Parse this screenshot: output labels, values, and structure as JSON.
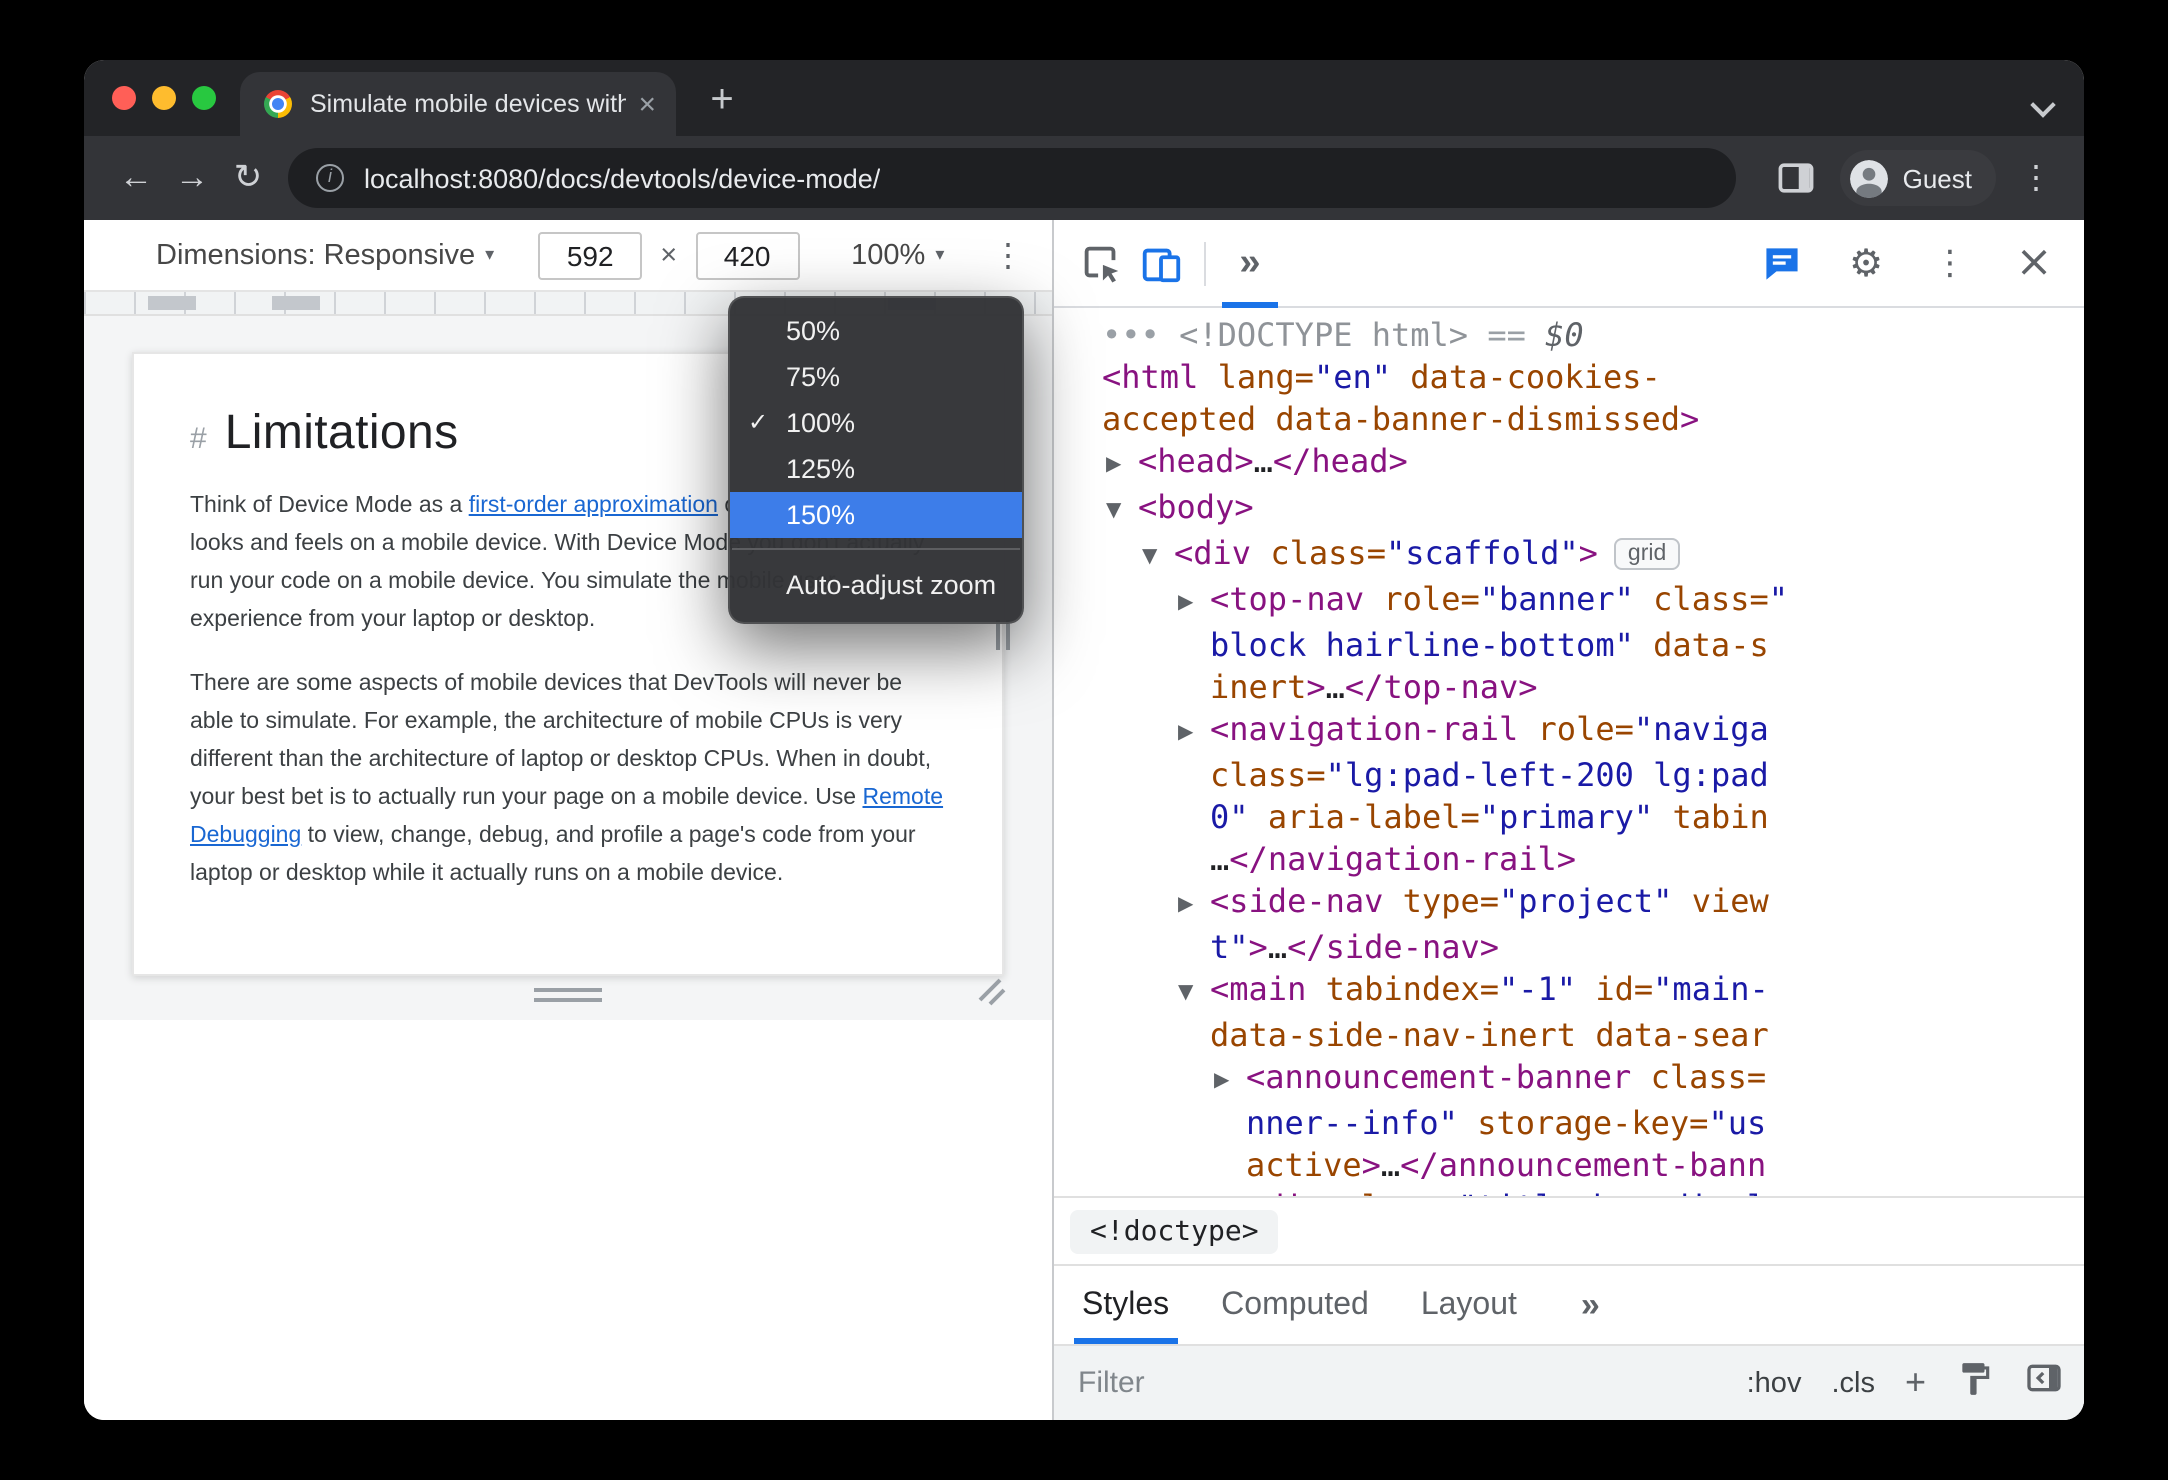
{
  "browser": {
    "tab_title": "Simulate mobile devices with D",
    "tab_close": "×",
    "new_tab": "+",
    "back": "←",
    "forward": "→",
    "reload": "↻",
    "info": "i",
    "url": "localhost:8080/docs/devtools/device-mode/",
    "profile": "Guest",
    "menu": "⋮"
  },
  "device_toolbar": {
    "dimensions_label": "Dimensions: Responsive",
    "caret": "▾",
    "width": "592",
    "times": "×",
    "height": "420",
    "zoom": "100%",
    "more": "⋮"
  },
  "zoom_menu": {
    "check": "✓",
    "items": [
      {
        "label": "50%",
        "checked": false,
        "selected": false
      },
      {
        "label": "75%",
        "checked": false,
        "selected": false
      },
      {
        "label": "100%",
        "checked": true,
        "selected": false
      },
      {
        "label": "125%",
        "checked": false,
        "selected": false
      },
      {
        "label": "150%",
        "checked": false,
        "selected": true
      }
    ],
    "footer": "Auto-adjust zoom",
    "highlight_color": "#3d7de9"
  },
  "page": {
    "heading_hash": "#",
    "heading": "Limitations",
    "para1": [
      {
        "t": "Think of Device Mode as a "
      },
      {
        "t": "first-order approximation",
        "link": true
      },
      {
        "t": " of how your page looks and feels on a mobile device. With Device Mode you don't actually run your code on a mobile device. You simulate the mobile user experience from your laptop or desktop."
      }
    ],
    "para2": [
      {
        "t": "There are some aspects of mobile devices that DevTools will never be able to simulate. For example, the architecture of mobile CPUs is very different than the architecture of laptop or desktop CPUs. When in doubt, your best bet is to actually run your page on a mobile device. Use "
      },
      {
        "t": "Remote Debugging",
        "link": true
      },
      {
        "t": " to view, change, debug, and profile a page's code from your laptop or desktop while it actually runs on a mobile device."
      }
    ]
  },
  "devtools": {
    "more_tabs": "»",
    "settings": "⚙",
    "menu": "⋮",
    "close": "×",
    "breadcrumb": "<!doctype>",
    "tabs": [
      {
        "label": "Styles",
        "active": true
      },
      {
        "label": "Computed",
        "active": false
      },
      {
        "label": "Layout",
        "active": false
      }
    ],
    "tabs_overflow": "»",
    "filter_placeholder": "Filter",
    "pseudo": ":hov",
    "cls": ".cls",
    "add": "+",
    "dom_lines": [
      {
        "indent": 0,
        "arrow": null,
        "parts": [
          {
            "t": "•••",
            "c": "gray"
          },
          {
            "t": " <!DOCTYPE html>",
            "c": "doct"
          },
          {
            "t": " == ",
            "c": "gray"
          },
          {
            "t": "$0",
            "c": "dollar"
          }
        ]
      },
      {
        "indent": 0,
        "arrow": null,
        "parts": [
          {
            "t": "<html ",
            "c": "tag"
          },
          {
            "t": "lang",
            "c": "attr"
          },
          {
            "t": "=",
            "c": "attr"
          },
          {
            "t": "\"en\"",
            "c": "val"
          },
          {
            "t": " ",
            "c": "plain"
          },
          {
            "t": "data-cookies-",
            "c": "attr"
          }
        ]
      },
      {
        "indent": 0,
        "cont": true,
        "parts": [
          {
            "t": "accepted data-banner-dismissed",
            "c": "attr"
          },
          {
            "t": ">",
            "c": "tag"
          }
        ]
      },
      {
        "indent": 1,
        "arrow": "r",
        "parts": [
          {
            "t": "<head>",
            "c": "tag"
          },
          {
            "t": "…",
            "c": "plain"
          },
          {
            "t": "</head>",
            "c": "tag"
          }
        ]
      },
      {
        "indent": 1,
        "arrow": "d",
        "parts": [
          {
            "t": "<body>",
            "c": "tag"
          }
        ]
      },
      {
        "indent": 2,
        "arrow": "d",
        "parts": [
          {
            "t": "<div ",
            "c": "tag"
          },
          {
            "t": "class",
            "c": "attr"
          },
          {
            "t": "=",
            "c": "attr"
          },
          {
            "t": "\"scaffold\"",
            "c": "val"
          },
          {
            "t": ">",
            "c": "tag"
          }
        ],
        "badge": "grid"
      },
      {
        "indent": 3,
        "arrow": "r",
        "parts": [
          {
            "t": "<top-nav ",
            "c": "tag"
          },
          {
            "t": "role",
            "c": "attr"
          },
          {
            "t": "=",
            "c": "attr"
          },
          {
            "t": "\"banner\"",
            "c": "val"
          },
          {
            "t": " ",
            "c": "plain"
          },
          {
            "t": "class=",
            "c": "attr"
          },
          {
            "t": "\"",
            "c": "val"
          }
        ]
      },
      {
        "indent": 3,
        "cont": true,
        "parts": [
          {
            "t": "block hairline-bottom\"",
            "c": "val"
          },
          {
            "t": " ",
            "c": "plain"
          },
          {
            "t": "data-s",
            "c": "attr"
          }
        ]
      },
      {
        "indent": 3,
        "cont": true,
        "parts": [
          {
            "t": "inert",
            "c": "attr"
          },
          {
            "t": ">",
            "c": "tag"
          },
          {
            "t": "…",
            "c": "plain"
          },
          {
            "t": "</top-nav>",
            "c": "tag"
          }
        ]
      },
      {
        "indent": 3,
        "arrow": "r",
        "parts": [
          {
            "t": "<navigation-rail ",
            "c": "tag"
          },
          {
            "t": "role",
            "c": "attr"
          },
          {
            "t": "=",
            "c": "attr"
          },
          {
            "t": "\"naviga",
            "c": "val"
          }
        ]
      },
      {
        "indent": 3,
        "cont": true,
        "parts": [
          {
            "t": "class",
            "c": "attr"
          },
          {
            "t": "=",
            "c": "attr"
          },
          {
            "t": "\"lg:pad-left-200 lg:pad",
            "c": "val"
          }
        ]
      },
      {
        "indent": 3,
        "cont": true,
        "parts": [
          {
            "t": "0\"",
            "c": "val"
          },
          {
            "t": " ",
            "c": "plain"
          },
          {
            "t": "aria-label",
            "c": "attr"
          },
          {
            "t": "=",
            "c": "attr"
          },
          {
            "t": "\"primary\"",
            "c": "val"
          },
          {
            "t": " ",
            "c": "plain"
          },
          {
            "t": "tabin",
            "c": "attr"
          }
        ]
      },
      {
        "indent": 3,
        "cont": true,
        "parts": [
          {
            "t": "…",
            "c": "plain"
          },
          {
            "t": "</navigation-rail>",
            "c": "tag"
          }
        ]
      },
      {
        "indent": 3,
        "arrow": "r",
        "parts": [
          {
            "t": "<side-nav ",
            "c": "tag"
          },
          {
            "t": "type",
            "c": "attr"
          },
          {
            "t": "=",
            "c": "attr"
          },
          {
            "t": "\"project\"",
            "c": "val"
          },
          {
            "t": " ",
            "c": "plain"
          },
          {
            "t": "view",
            "c": "attr"
          }
        ]
      },
      {
        "indent": 3,
        "cont": true,
        "parts": [
          {
            "t": "t\"",
            "c": "val"
          },
          {
            "t": ">",
            "c": "tag"
          },
          {
            "t": "…",
            "c": "plain"
          },
          {
            "t": "</side-nav>",
            "c": "tag"
          }
        ]
      },
      {
        "indent": 3,
        "arrow": "d",
        "parts": [
          {
            "t": "<main ",
            "c": "tag"
          },
          {
            "t": "tabindex",
            "c": "attr"
          },
          {
            "t": "=",
            "c": "attr"
          },
          {
            "t": "\"-1\"",
            "c": "val"
          },
          {
            "t": " ",
            "c": "plain"
          },
          {
            "t": "id",
            "c": "attr"
          },
          {
            "t": "=",
            "c": "attr"
          },
          {
            "t": "\"main-",
            "c": "val"
          }
        ]
      },
      {
        "indent": 3,
        "cont": true,
        "parts": [
          {
            "t": "data-side-nav-inert data-sear",
            "c": "attr"
          }
        ]
      },
      {
        "indent": 4,
        "arrow": "r",
        "parts": [
          {
            "t": "<announcement-banner ",
            "c": "tag"
          },
          {
            "t": "class=",
            "c": "attr"
          }
        ]
      },
      {
        "indent": 4,
        "cont": true,
        "parts": [
          {
            "t": "nner--info\"",
            "c": "val"
          },
          {
            "t": " ",
            "c": "plain"
          },
          {
            "t": "storage-key",
            "c": "attr"
          },
          {
            "t": "=",
            "c": "attr"
          },
          {
            "t": "\"us",
            "c": "val"
          }
        ]
      },
      {
        "indent": 4,
        "cont": true,
        "parts": [
          {
            "t": "active",
            "c": "attr"
          },
          {
            "t": ">",
            "c": "tag"
          },
          {
            "t": "…",
            "c": "plain"
          },
          {
            "t": "</announcement-bann",
            "c": "tag"
          }
        ]
      },
      {
        "indent": 4,
        "arrow": "r",
        "parts": [
          {
            "t": "<div ",
            "c": "tag"
          },
          {
            "t": "class",
            "c": "attr"
          },
          {
            "t": "=",
            "c": "attr"
          },
          {
            "t": "\"title-bar displ",
            "c": "val"
          }
        ]
      }
    ]
  },
  "colors": {
    "accent": "#1a73e8",
    "selection_blue": "#3d7de9",
    "tag": "#881280",
    "attribute": "#994500",
    "value": "#1a1aa6",
    "link": "#1967d2"
  }
}
